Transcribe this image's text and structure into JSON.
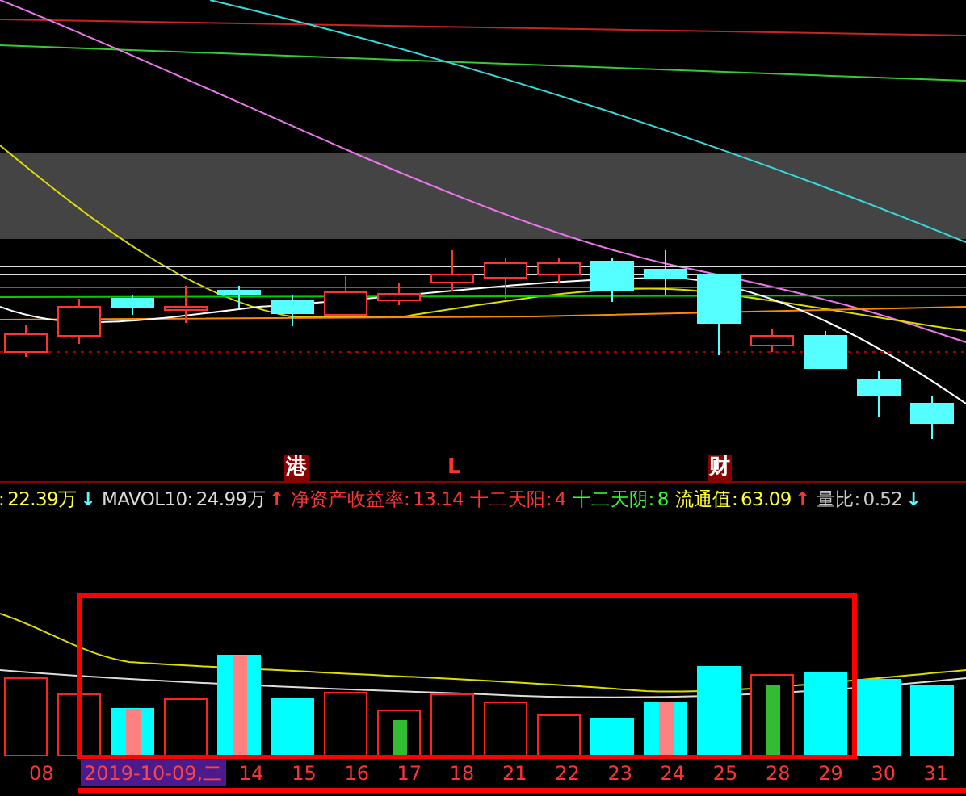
{
  "markers": [
    {
      "label": "港",
      "kind": "badge"
    },
    {
      "label": "L",
      "kind": "letter"
    },
    {
      "label": "财",
      "kind": "badge"
    }
  ],
  "indicators": [
    {
      "label": ":",
      "value": "22.39万",
      "color": "#ffff33",
      "arrow": {
        "label": "↓",
        "color": "#55ffff"
      }
    },
    {
      "label": "MAVOL10:",
      "value": "24.99万",
      "color": "#dddddd",
      "arrow": {
        "label": "↑",
        "color": "#ff3333"
      }
    },
    {
      "label": "净资产收益率:",
      "value": "13.14",
      "color": "#ff3333"
    },
    {
      "label": "十二天阳:",
      "value": "4",
      "color": "#ff3333"
    },
    {
      "label": "十二天阴:",
      "value": "8",
      "color": "#33ff33"
    },
    {
      "label": "流通值:",
      "value": "63.09",
      "color": "#ffff33",
      "arrow": {
        "label": "↑",
        "color": "#ff3333"
      }
    },
    {
      "label": "量比:",
      "value": "0.52",
      "color": "#cccccc",
      "arrow": {
        "label": "↓",
        "color": "#55ffff"
      }
    }
  ],
  "axis_labels": [
    {
      "label": "08",
      "kind": "day"
    },
    {
      "label": "2019-10-09,二",
      "kind": "date"
    },
    {
      "label": "14",
      "kind": "day"
    },
    {
      "label": "15",
      "kind": "day"
    },
    {
      "label": "16",
      "kind": "day"
    },
    {
      "label": "17",
      "kind": "day"
    },
    {
      "label": "18",
      "kind": "day"
    },
    {
      "label": "21",
      "kind": "day"
    },
    {
      "label": "22",
      "kind": "day"
    },
    {
      "label": "23",
      "kind": "day"
    },
    {
      "label": "24",
      "kind": "day"
    },
    {
      "label": "25",
      "kind": "day"
    },
    {
      "label": "28",
      "kind": "day"
    },
    {
      "label": "29",
      "kind": "day"
    },
    {
      "label": "30",
      "kind": "day"
    },
    {
      "label": "31",
      "kind": "day"
    }
  ]
}
